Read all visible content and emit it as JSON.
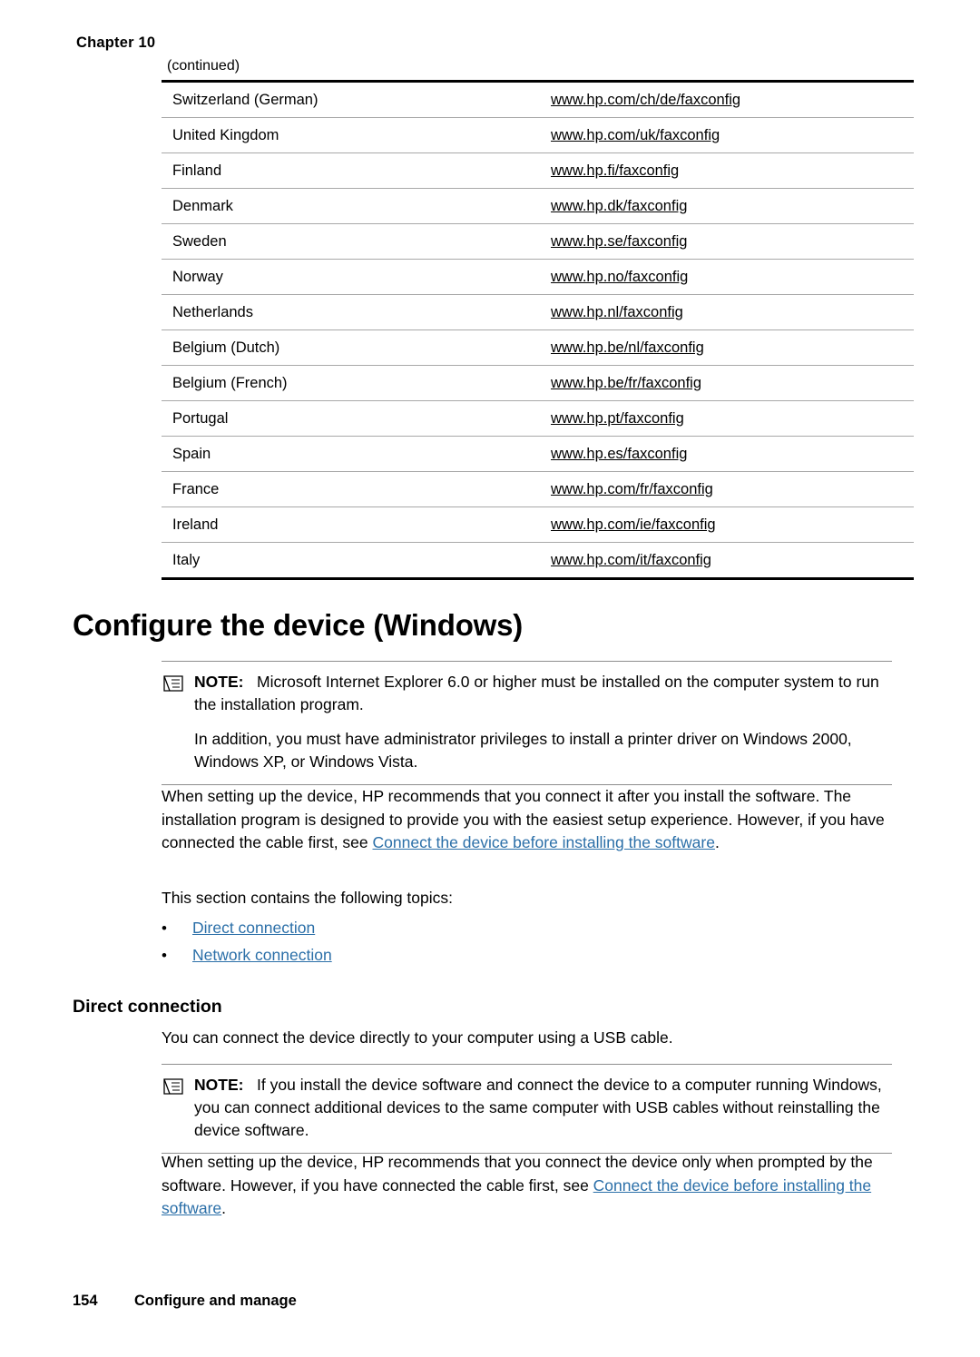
{
  "header": {
    "chapter": "Chapter 10",
    "continued": "(continued)"
  },
  "table": {
    "rows": [
      {
        "country": "Switzerland (German)",
        "url": "www.hp.com/ch/de/faxconfig"
      },
      {
        "country": "United Kingdom",
        "url": "www.hp.com/uk/faxconfig"
      },
      {
        "country": "Finland",
        "url": "www.hp.fi/faxconfig"
      },
      {
        "country": "Denmark",
        "url": "www.hp.dk/faxconfig"
      },
      {
        "country": "Sweden",
        "url": "www.hp.se/faxconfig"
      },
      {
        "country": "Norway",
        "url": "www.hp.no/faxconfig"
      },
      {
        "country": "Netherlands",
        "url": "www.hp.nl/faxconfig"
      },
      {
        "country": "Belgium (Dutch)",
        "url": "www.hp.be/nl/faxconfig"
      },
      {
        "country": "Belgium (French)",
        "url": "www.hp.be/fr/faxconfig"
      },
      {
        "country": "Portugal",
        "url": "www.hp.pt/faxconfig"
      },
      {
        "country": "Spain",
        "url": "www.hp.es/faxconfig"
      },
      {
        "country": "France",
        "url": "www.hp.com/fr/faxconfig"
      },
      {
        "country": "Ireland",
        "url": "www.hp.com/ie/faxconfig"
      },
      {
        "country": "Italy",
        "url": "www.hp.com/it/faxconfig"
      }
    ]
  },
  "section": {
    "title": "Configure the device (Windows)"
  },
  "note1": {
    "label": "NOTE:",
    "text": "Microsoft Internet Explorer 6.0 or higher must be installed on the computer system to run the installation program.",
    "para2": "In addition, you must have administrator privileges to install a printer driver on Windows 2000, Windows XP, or Windows Vista."
  },
  "intro": {
    "text_before_link": "When setting up the device, HP recommends that you connect it after you install the software. The installation program is designed to provide you with the easiest setup experience. However, if you have connected the cable first, see ",
    "link": "Connect the device before installing the software",
    "text_after_link": ".",
    "topics_line": "This section contains the following topics:"
  },
  "bullets": [
    {
      "bullet": "•",
      "label": "Direct connection"
    },
    {
      "bullet": "•",
      "label": "Network connection"
    }
  ],
  "subsection": {
    "title": "Direct connection",
    "body": "You can connect the device directly to your computer using a USB cable."
  },
  "note2": {
    "label": "NOTE:",
    "text": "If you install the device software and connect the device to a computer running Windows, you can connect additional devices to the same computer with USB cables without reinstalling the device software."
  },
  "closing": {
    "text_before_link": "When setting up the device, HP recommends that you connect the device only when prompted by the software. However, if you have connected the cable first, see ",
    "link": "Connect the device before installing the software",
    "text_after_link": "."
  },
  "footer": {
    "page_number": "154",
    "text": "Configure and manage"
  },
  "colors": {
    "link": "#2b6fa8",
    "rule": "#000000",
    "row_rule": "#a8a8a8"
  }
}
